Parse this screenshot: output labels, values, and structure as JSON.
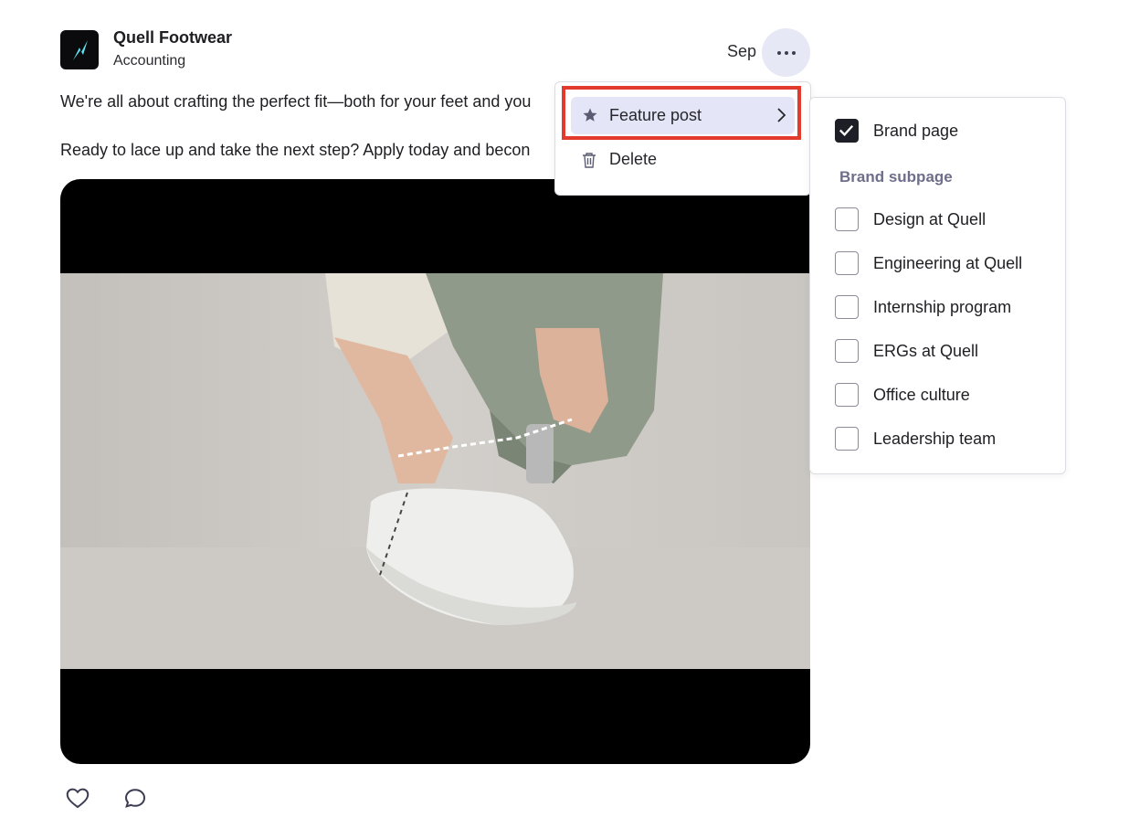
{
  "post": {
    "company_name": "Quell Footwear",
    "company_category": "Accounting",
    "date": "Sep",
    "text_line1": "We're all about crafting the perfect fit—both for your feet and you",
    "text_line2": "Ready to lace up and take the next step? Apply today and becon"
  },
  "menu": {
    "feature_label": "Feature post",
    "delete_label": "Delete"
  },
  "submenu": {
    "brand_page": {
      "label": "Brand page",
      "checked": true
    },
    "heading": "Brand subpage",
    "items": [
      {
        "label": "Design at Quell",
        "checked": false
      },
      {
        "label": "Engineering at Quell",
        "checked": false
      },
      {
        "label": "Internship program",
        "checked": false
      },
      {
        "label": "ERGs at Quell",
        "checked": false
      },
      {
        "label": "Office culture",
        "checked": false
      },
      {
        "label": "Leadership team",
        "checked": false
      }
    ]
  },
  "icons": {
    "more": "more-horizontal-icon",
    "feature": "star-icon",
    "delete": "trash-icon",
    "submenu": "chevron-right-icon",
    "like": "heart-icon",
    "comment": "comment-icon"
  },
  "colors": {
    "menu_highlight": "#e4e6f7",
    "annotation_box": "#e23a2c",
    "subheading": "#6d6e8a",
    "logo_accent": "#5ee1f2"
  }
}
